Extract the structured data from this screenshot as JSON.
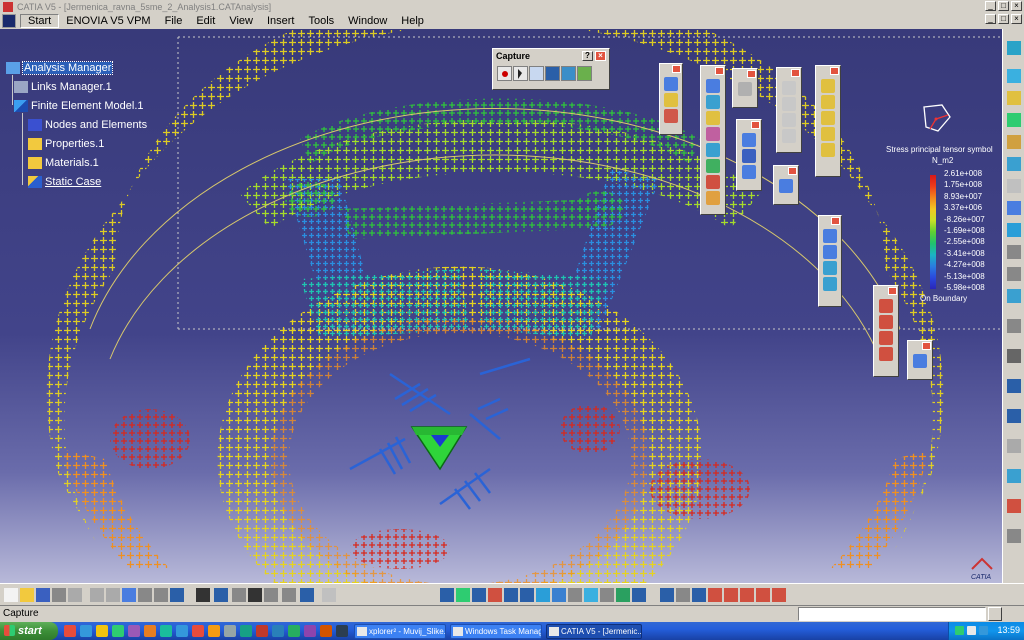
{
  "window": {
    "title": "CATIA V5 - [Jermenica_ravna_5sme_2_Analysis1.CATAnalysis]",
    "controls": [
      "_",
      "□",
      "×"
    ]
  },
  "menu": {
    "items": [
      "Start",
      "ENOVIA V5 VPM",
      "File",
      "Edit",
      "View",
      "Insert",
      "Tools",
      "Window",
      "Help"
    ],
    "active_index": 0
  },
  "tree": {
    "nodes": [
      {
        "label": "Analysis Manager",
        "icon": "analysis-manager-icon",
        "selected": true
      },
      {
        "label": "Links Manager.1",
        "icon": "links-manager-icon"
      },
      {
        "label": "Finite Element Model.1",
        "icon": "fem-icon"
      },
      {
        "label": "Nodes and Elements",
        "icon": "nodes-elements-icon"
      },
      {
        "label": "Properties.1",
        "icon": "folder-icon"
      },
      {
        "label": "Materials.1",
        "icon": "folder-icon"
      },
      {
        "label": "Static Case",
        "icon": "static-case-icon",
        "underline": true
      }
    ]
  },
  "capture_toolbar": {
    "title": "Capture",
    "help": "?",
    "close": "×",
    "icons": [
      "record-icon",
      "select-icon",
      "capture-icon",
      "screen-icon",
      "album-icon",
      "options-icon"
    ]
  },
  "legend": {
    "title": "Stress principal tensor symbol",
    "unit": "N_m2",
    "values": [
      "2.61e+008",
      "1.75e+008",
      "8.93e+007",
      "3.37e+006",
      "-8.26e+007",
      "-1.69e+008",
      "-2.55e+008",
      "-3.41e+008",
      "-4.27e+008",
      "-5.13e+008",
      "-5.98e+008"
    ],
    "footer": "On Boundary",
    "colors": [
      "#d71818",
      "#f3861d",
      "#f1c722",
      "#c7e027",
      "#5fd032",
      "#21c26e",
      "#1bb3c4",
      "#2a7de0",
      "#2a49dd",
      "#2a26b8"
    ]
  },
  "status": {
    "text": "Capture"
  },
  "taskbar": {
    "start_label": "start",
    "tasks": [
      {
        "label": "xplorer² - Muvij_Slike..."
      },
      {
        "label": "Windows Task Manager"
      },
      {
        "label": "CATIA V5 - [Jermenic...",
        "active": true
      }
    ],
    "clock": "13:59"
  },
  "logo_text": "CATIA"
}
